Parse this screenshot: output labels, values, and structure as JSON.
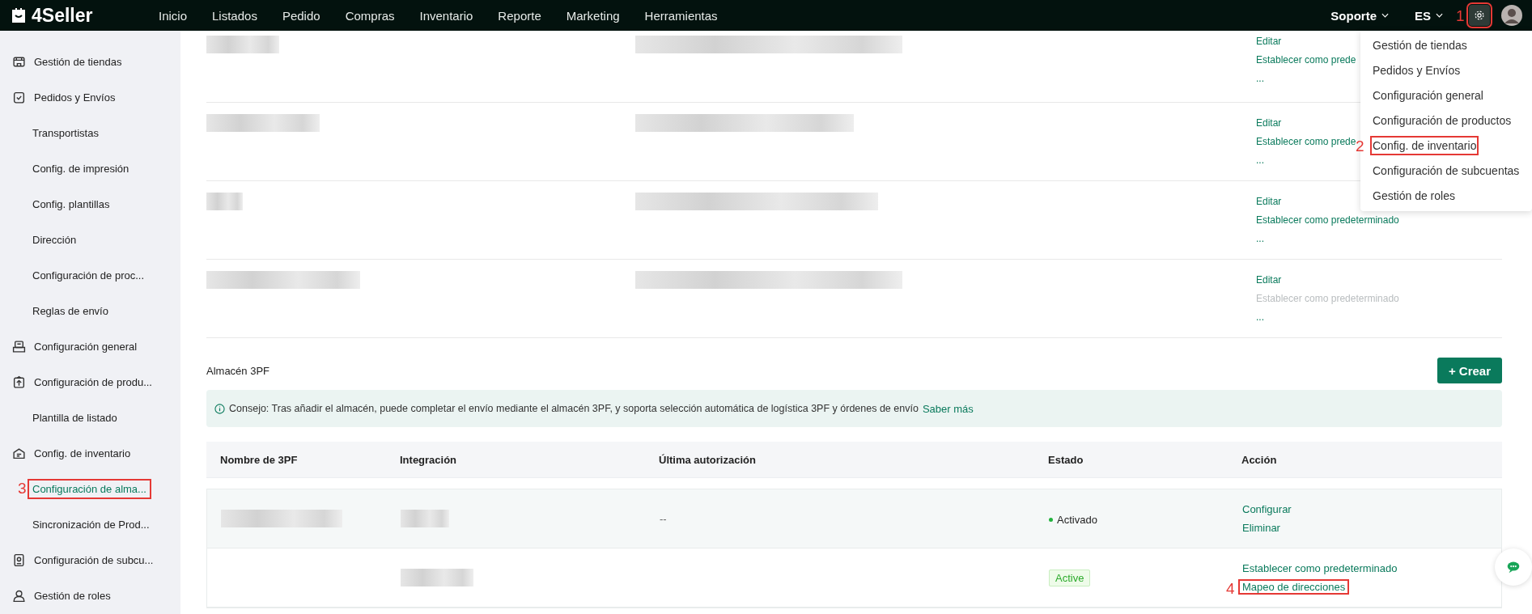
{
  "topbar": {
    "logo": "4Seller",
    "nav": [
      "Inicio",
      "Listados",
      "Pedido",
      "Compras",
      "Inventario",
      "Reporte",
      "Marketing",
      "Herramientas"
    ],
    "support": "Soporte",
    "language": "ES",
    "settings_marker": "1"
  },
  "settings_menu": [
    {
      "label": "Gestión de tiendas"
    },
    {
      "label": "Pedidos y Envíos"
    },
    {
      "label": "Configuración general"
    },
    {
      "label": "Configuración de productos"
    },
    {
      "label": "Config. de inventario",
      "marker": "2"
    },
    {
      "label": "Configuración de subcuentas"
    },
    {
      "label": "Gestión de roles"
    }
  ],
  "sidebar": [
    {
      "label": "Gestión de tiendas",
      "selected": false
    },
    {
      "label": "Pedidos y Envíos",
      "selected": false,
      "children": [
        {
          "label": "Transportistas",
          "selected": false
        },
        {
          "label": "Config. de impresión",
          "selected": false
        },
        {
          "label": "Config. plantillas",
          "selected": false
        },
        {
          "label": "Dirección",
          "selected": false
        },
        {
          "label": "Configuración de proc...",
          "selected": false
        },
        {
          "label": "Reglas de envío",
          "selected": false
        }
      ]
    },
    {
      "label": "Configuración general",
      "selected": false
    },
    {
      "label": "Configuración de produ...",
      "selected": false,
      "children": [
        {
          "label": "Plantilla de listado",
          "selected": false
        }
      ]
    },
    {
      "label": "Config. de inventario",
      "selected": false,
      "children": [
        {
          "label": "Configuración de alma...",
          "selected": true,
          "marker": "3"
        },
        {
          "label": "Sincronización de Prod...",
          "selected": false
        }
      ]
    },
    {
      "label": "Configuración de subcu...",
      "selected": false
    },
    {
      "label": "Gestión de roles",
      "selected": false
    }
  ],
  "warehouses": [
    {
      "actions": [
        {
          "label": "Editar",
          "disabled": false
        },
        {
          "label": "Establecer como prede",
          "disabled": false
        },
        {
          "label": "...",
          "disabled": false
        }
      ]
    },
    {
      "actions": [
        {
          "label": "Editar",
          "disabled": false
        },
        {
          "label": "Establecer como prede",
          "disabled": false
        },
        {
          "label": "...",
          "disabled": false
        }
      ]
    },
    {
      "actions": [
        {
          "label": "Editar",
          "disabled": false
        },
        {
          "label": "Establecer como predeterminado",
          "disabled": false
        },
        {
          "label": "...",
          "disabled": false
        }
      ]
    },
    {
      "actions": [
        {
          "label": "Editar",
          "disabled": false
        },
        {
          "label": "Establecer como predeterminado",
          "disabled": true
        },
        {
          "label": "...",
          "disabled": false
        }
      ]
    }
  ],
  "section_3pf": {
    "title": "Almacén 3PF",
    "create_button": "+ Crear",
    "tip": "Consejo: Tras añadir el almacén, puede completar el envío mediante el almacén 3PF, y soporta selección automática de logística 3PF y órdenes de envío",
    "tip_link": "Saber más",
    "columns": [
      "Nombre de 3PF",
      "Integración",
      "Última autorización",
      "Estado",
      "Acción"
    ],
    "rows": [
      {
        "last_auth": "--",
        "status": {
          "kind": "dot",
          "label": "Activado"
        },
        "actions": [
          {
            "label": "Configurar"
          },
          {
            "label": "Eliminar"
          }
        ]
      },
      {
        "status": {
          "kind": "tag",
          "label": "Active"
        },
        "actions": [
          {
            "label": "Establecer como predeterminado"
          },
          {
            "label": "Mapeo de direcciones",
            "marker": "4"
          }
        ]
      }
    ]
  }
}
